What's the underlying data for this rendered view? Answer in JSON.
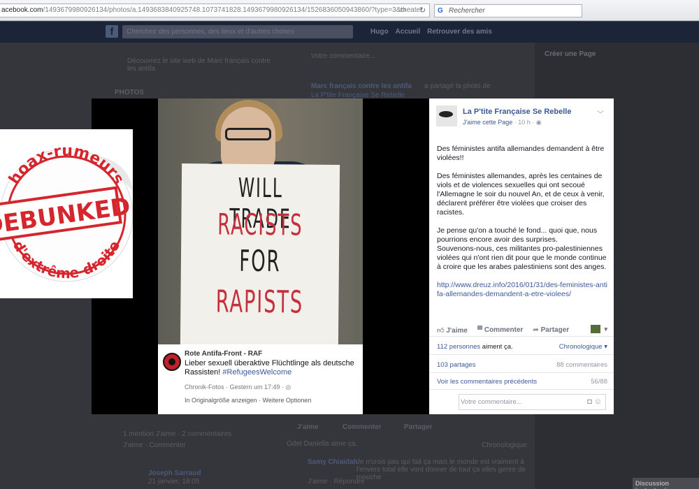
{
  "browser": {
    "url_host": "acebook.com",
    "url_path": "/1493679980926134/photos/a.1493683840925748.1073741828.1493679980926134/1526836050943860/?type=3&theater",
    "search_placeholder": "Rechercher",
    "search_engine_glyph": "G"
  },
  "fb_bar": {
    "logo": "f",
    "search_placeholder": "Cherchez des personnes, des lieux et d'autres choses",
    "nav": [
      "Hugo",
      "Accueil",
      "Retrouver des amis"
    ]
  },
  "background": {
    "photos_label": "PHOTOS",
    "left_text": "Découvrez le site web de Marc français contre les antifa",
    "post_author": "Marc français contre les antifa",
    "post_action": "a partagé la photo de",
    "post_page": "La P'tite Française Se Rebelle",
    "create_page": "Créer une Page",
    "comment_placeholder": "Votre commentaire...",
    "likes_line": "1 mention J'aime · 2 commentaires",
    "like_comment": "J'aime · Commenter",
    "bottom_like": "J'aime",
    "bottom_comment": "Commenter",
    "bottom_share": "Partager",
    "odet": "Odet Daniella aime ça.",
    "chronologique": "Chronologique",
    "commenter_name": "Samy Chiaidah",
    "commenter_text": "Je n'crois pas qui fait ça mais le monde est vraiment à l'envers total elle vont donner de tout ça elles genre de mouche",
    "comment_actions": "J'aime · Répondre",
    "joseph": "Joseph Sarraud",
    "joseph_date": "21 janvier, 18:05",
    "discussion": "Discussion instantanée"
  },
  "photo": {
    "sign_lines": [
      "WILL TRADE",
      "RACISTS",
      "FOR",
      "RAPISTS"
    ],
    "card": {
      "name": "Rote Antifa-Front - RAF",
      "text": "Lieber sexuell überaktive Flüchtlinge als deutsche Rassisten!",
      "hashtag": "#RefugeesWelcome",
      "meta": "Chronik-Fotos · Gestern um 17:49 · ◎",
      "links": "In Originalgröße anzeigen · Weitere Optionen"
    }
  },
  "sticker": {
    "top_text": "hoax-rumeurs",
    "center_text": "DEBUNKED",
    "bottom_text": "d'extrême-droite",
    "color": "#d4262c"
  },
  "panel": {
    "page_name": "La P'tite Française Se Rebelle",
    "like_page": "J'aime cette Page",
    "time": "· 10 h · ◉",
    "paragraphs": [
      "Des féministes antifa allemandes demandent à être violées!!",
      "Des féministes allemandes, après les centaines de viols et de violences sexuelles qui ont secoué l'Allemagne le soir du nouvel An, et de ceux à venir, déclarent préférer être violées que croiser des racistes.",
      "Je pense qu'on a touché le fond... quoi que, nous pourrions encore avoir des surprises.\nSouvenons-nous, ces militantes pro-palestiniennes violées qui n'ont rien dit pour que le monde continue à croire que les arabes palestiniens sont des anges."
    ],
    "link": "http://www.dreuz.info/2016/01/31/des-feministes-antifa-allemandes-demandent-a-etre-violees/",
    "actions": {
      "like": "J'aime",
      "comment": "Commenter",
      "share": "Partager"
    },
    "likes_count": "112 personnes",
    "likes_suffix": "aiment ça.",
    "chronological": "Chronologique ▾",
    "shares": "103 partages",
    "comments_count": "88 commentaires",
    "previous_comments": "Voir les commentaires précédents",
    "comments_ratio": "56/88",
    "comment_placeholder": "Votre commentaire..."
  }
}
